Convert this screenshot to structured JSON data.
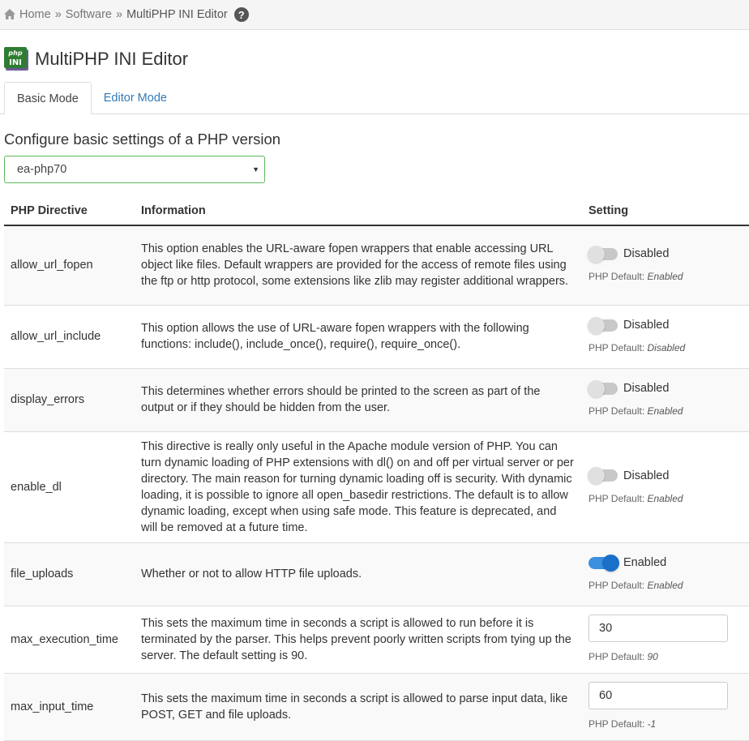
{
  "breadcrumb": {
    "home": "Home",
    "software": "Software",
    "current": "MultiPHP INI Editor",
    "separator": "»"
  },
  "page": {
    "title": "MultiPHP INI Editor",
    "icon_text_top": "php",
    "icon_text_bottom": "INI"
  },
  "tabs": [
    {
      "label": "Basic Mode",
      "active": true
    },
    {
      "label": "Editor Mode",
      "active": false
    }
  ],
  "section_heading": "Configure basic settings of a PHP version",
  "version_select": {
    "selected": "ea-php70"
  },
  "table": {
    "headers": {
      "directive": "PHP Directive",
      "information": "Information",
      "setting": "Setting"
    },
    "default_prefix": "PHP Default:",
    "rows": [
      {
        "name": "allow_url_fopen",
        "info": "This option enables the URL-aware fopen wrappers that enable accessing URL object like files. Default wrappers are provided for the access of remote files using the ftp or http protocol, some extensions like zlib may register additional wrappers.",
        "type": "toggle",
        "state": "Disabled",
        "on": false,
        "default": "Enabled"
      },
      {
        "name": "allow_url_include",
        "info": "This option allows the use of URL-aware fopen wrappers with the following functions: include(), include_once(), require(), require_once().",
        "type": "toggle",
        "state": "Disabled",
        "on": false,
        "default": "Disabled"
      },
      {
        "name": "display_errors",
        "info": "This determines whether errors should be printed to the screen as part of the output or if they should be hidden from the user.",
        "type": "toggle",
        "state": "Disabled",
        "on": false,
        "default": "Enabled"
      },
      {
        "name": "enable_dl",
        "info": "This directive is really only useful in the Apache module version of PHP. You can turn dynamic loading of PHP extensions with dl() on and off per virtual server or per directory. The main reason for turning dynamic loading off is security. With dynamic loading, it is possible to ignore all open_basedir restrictions. The default is to allow dynamic loading, except when using safe mode. This feature is deprecated, and will be removed at a future time.",
        "type": "toggle",
        "state": "Disabled",
        "on": false,
        "default": "Enabled"
      },
      {
        "name": "file_uploads",
        "info": "Whether or not to allow HTTP file uploads.",
        "type": "toggle",
        "state": "Enabled",
        "on": true,
        "default": "Enabled"
      },
      {
        "name": "max_execution_time",
        "info": "This sets the maximum time in seconds a script is allowed to run before it is terminated by the parser. This helps prevent poorly written scripts from tying up the server. The default setting is 90.",
        "type": "input",
        "value": "30",
        "default": "90"
      },
      {
        "name": "max_input_time",
        "info": "This sets the maximum time in seconds a script is allowed to parse input data, like POST, GET and file uploads.",
        "type": "input",
        "value": "60",
        "default": "-1"
      }
    ]
  },
  "colors": {
    "link": "#337ab7",
    "toggle_on": "#1a6fc8",
    "select_border": "#5cb85c"
  }
}
